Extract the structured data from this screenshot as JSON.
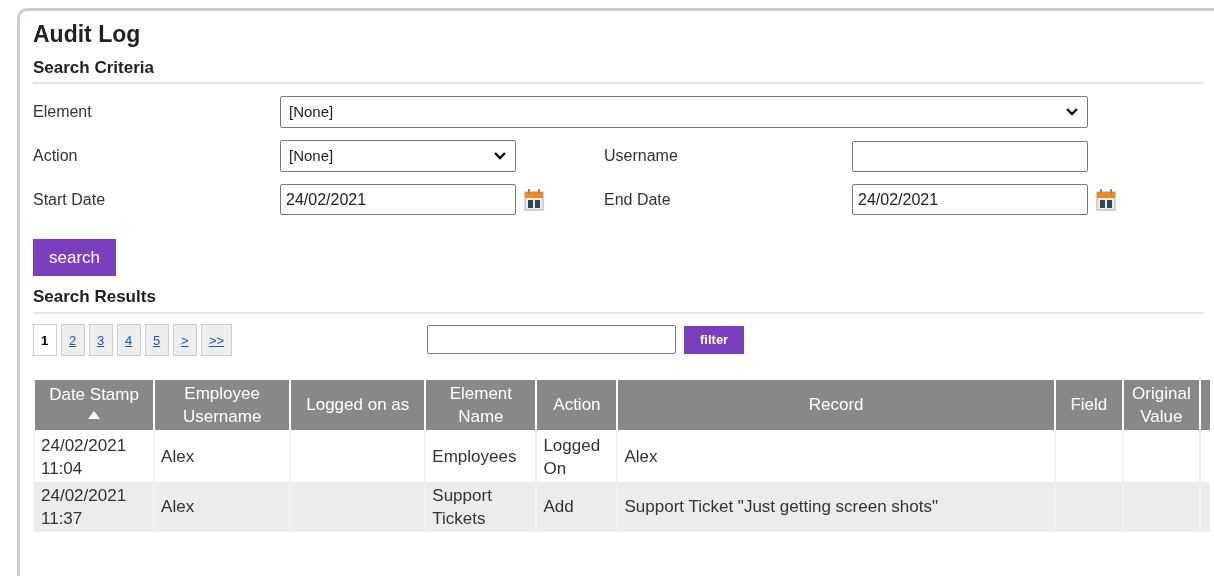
{
  "title": "Audit Log",
  "criteria": {
    "heading": "Search Criteria",
    "fields": [
      {
        "kind": "select",
        "label": "Element",
        "value": "[None]",
        "wide": true
      },
      {
        "kind": "select",
        "label": "Action",
        "value": "[None]"
      },
      {
        "kind": "text",
        "label": "Username"
      },
      {
        "kind": "date",
        "label": "Start Date",
        "value": "24/02/2021"
      },
      {
        "kind": "date",
        "label": "End Date",
        "value": "24/02/2021"
      }
    ],
    "search_button": "search"
  },
  "results": {
    "heading": "Search Results",
    "pages": [
      {
        "label": "1",
        "selected": true
      },
      {
        "label": "2",
        "selected": false
      },
      {
        "label": "3",
        "selected": false
      },
      {
        "label": "4",
        "selected": false
      },
      {
        "label": "5",
        "selected": false
      },
      {
        "label": ">",
        "selected": false
      },
      {
        "label": ">>",
        "selected": false
      }
    ],
    "filter_button": "filter",
    "table": {
      "columns": [
        {
          "label": "Date Stamp",
          "sorted": true
        },
        {
          "label": "Employee Username",
          "sorted": false
        },
        {
          "label": "Logged on as",
          "sorted": false
        },
        {
          "label": "Element Name",
          "sorted": false
        },
        {
          "label": "Action",
          "sorted": false
        },
        {
          "label": "Record",
          "sorted": false
        },
        {
          "label": "Field",
          "sorted": false
        },
        {
          "label": "Original Value",
          "sorted": false
        }
      ],
      "rows": [
        [
          "24/02/2021 11:04",
          "Alex",
          "",
          "Employees",
          "Logged On",
          "Alex",
          "",
          ""
        ],
        [
          "24/02/2021 11:37",
          "Alex",
          "",
          "Support Tickets",
          "Add",
          "Support Ticket \"Just getting screen shots\"",
          "",
          ""
        ]
      ]
    }
  }
}
